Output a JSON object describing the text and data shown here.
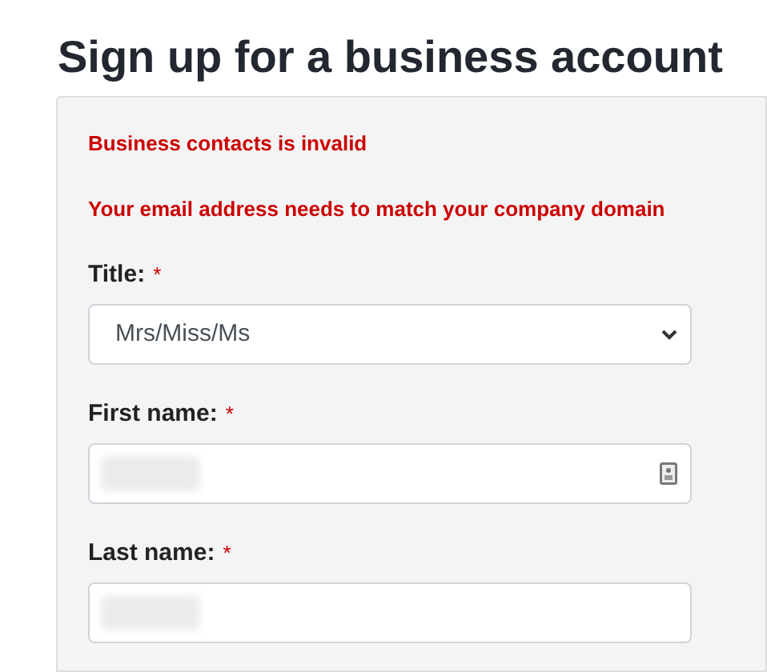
{
  "heading": "Sign up for a business account",
  "errors": [
    "Business contacts is invalid",
    "Your email address needs to match your company domain"
  ],
  "fields": [
    {
      "kind": "select",
      "label": "Title:",
      "required_mark": "*",
      "value": "Mrs/Miss/Ms"
    },
    {
      "kind": "text",
      "label": "First name:",
      "required_mark": "*",
      "redacted": true,
      "autofill_icon": true
    },
    {
      "kind": "text",
      "label": "Last name:",
      "required_mark": "*",
      "redacted": true,
      "autofill_icon": false
    }
  ]
}
